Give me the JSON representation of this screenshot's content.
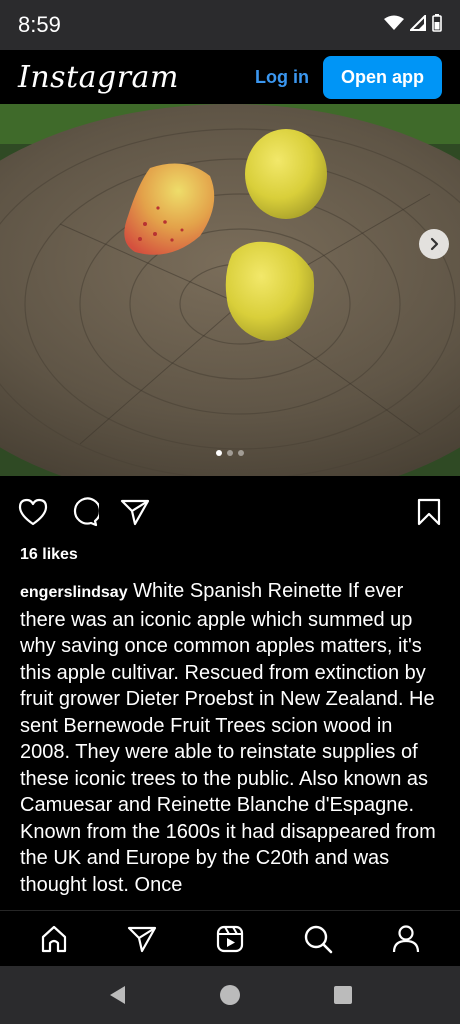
{
  "status_bar": {
    "time": "8:59",
    "icons": [
      "wifi-icon",
      "signal-icon",
      "battery-icon"
    ]
  },
  "header": {
    "logo": "Instagram",
    "login_label": "Log in",
    "open_app_label": "Open app"
  },
  "post": {
    "image_alt": "Three small yellow apples on a wooden stump",
    "carousel": {
      "total": 3,
      "active": 1
    },
    "actions": [
      "like-icon",
      "comment-icon",
      "share-icon",
      "save-icon"
    ],
    "likes": "16 likes",
    "username": "engerslindsay",
    "caption": "White Spanish Reinette If ever there was an iconic apple which summed up why saving once common apples matters, it's this apple cultivar. Rescued from extinction by fruit grower Dieter Proebst in New Zealand. He sent Bernewode Fruit Trees scion wood in 2008. They were able to reinstate supplies of these iconic trees to the public. Also known as Camuesar and Reinette Blanche d'Espagne. Known from the 1600s it had disappeared from the UK and Europe by the C20th and was thought lost. Once"
  },
  "bottom_nav": [
    "home-icon",
    "direct-icon",
    "reels-icon",
    "search-icon",
    "profile-icon"
  ],
  "android_nav": [
    "back-icon",
    "home-circle-icon",
    "recents-icon"
  ],
  "colors": {
    "accent": "#0095f6",
    "link": "#3b97f0",
    "background": "#000000",
    "system_bar": "#2b2b2d"
  }
}
